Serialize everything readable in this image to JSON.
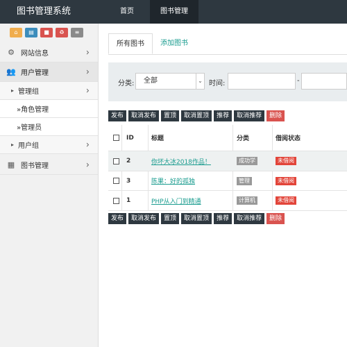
{
  "header": {
    "logo": "图书管理系统",
    "nav": [
      {
        "label": "首页"
      },
      {
        "label": "图书管理"
      }
    ]
  },
  "sidebar": {
    "shortcuts": [
      {
        "icon": "home-icon",
        "color": "#f0ad4e"
      },
      {
        "icon": "file-icon",
        "color": "#3c8dbc"
      },
      {
        "icon": "trash-icon",
        "color": "#d9534f"
      },
      {
        "icon": "recycle-icon",
        "color": "#d9534f"
      },
      {
        "icon": "list-icon",
        "color": "#8a8a8a"
      }
    ],
    "menu": {
      "site_info": "网站信息",
      "user_mgmt": "用户管理",
      "admin_group": "管理组",
      "role_mgmt": "»角色管理",
      "admin": "»管理员",
      "user_group": "用户组",
      "book_mgmt": "图书管理"
    }
  },
  "main": {
    "tabs": [
      {
        "label": "所有图书"
      },
      {
        "label": "添加图书"
      }
    ],
    "filter": {
      "category_label": "分类:",
      "category_value": "全部",
      "time_label": "时间:",
      "dash": "-"
    },
    "actions": [
      "发布",
      "取消发布",
      "置顶",
      "取消置顶",
      "推荐",
      "取消推荐",
      "删除"
    ],
    "table": {
      "headers": {
        "id": "ID",
        "title": "标题",
        "category": "分类",
        "status": "借阅状态"
      },
      "rows": [
        {
          "id": "2",
          "title": "你坏大冰2018作品！",
          "category": "成功学",
          "status": "未借阅"
        },
        {
          "id": "3",
          "title": "陈果：好的孤独",
          "category": "管理",
          "status": "未借阅"
        },
        {
          "id": "1",
          "title": "PHP从入门到精通",
          "category": "计算机",
          "status": "未借阅"
        }
      ]
    }
  },
  "colors": {
    "header_bg": "#2e3840",
    "accent_teal": "#1a9c8f",
    "danger_red": "#d9534f"
  }
}
